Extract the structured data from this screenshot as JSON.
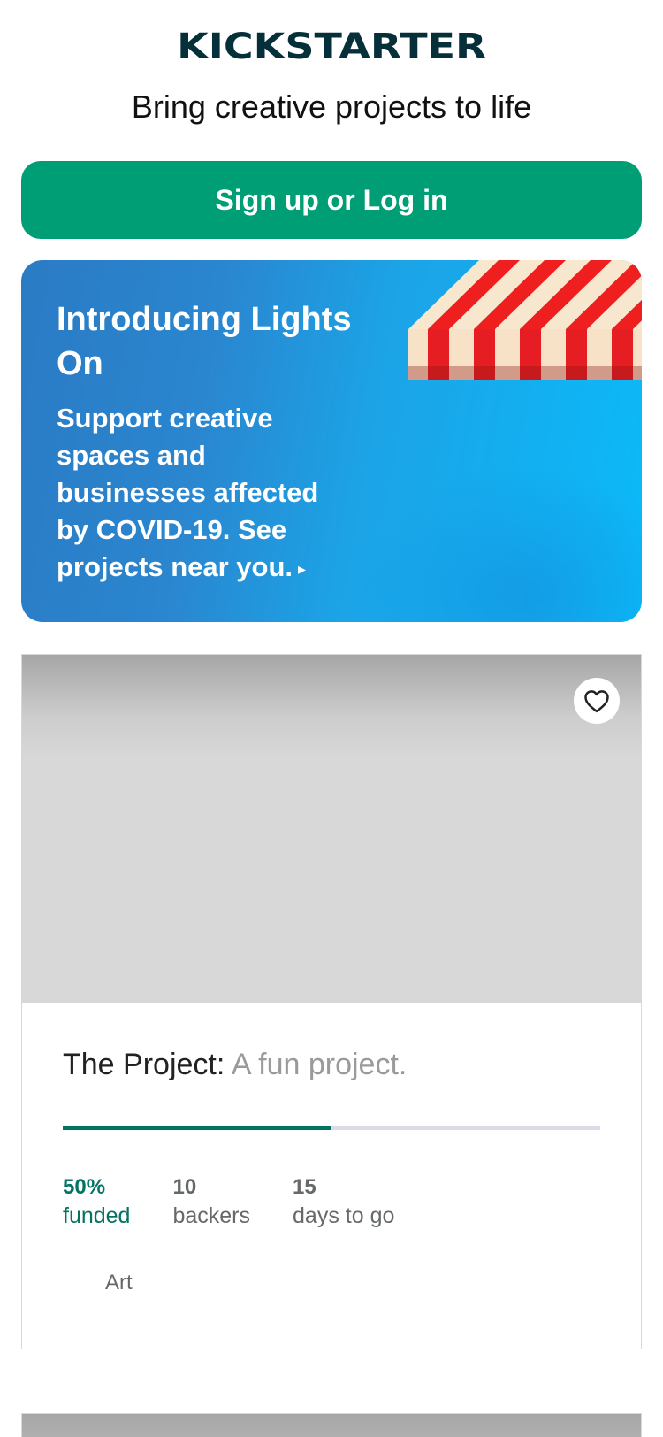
{
  "header": {
    "logo_text": "KICKSTARTER",
    "tagline": "Bring creative projects to life"
  },
  "auth": {
    "signup_label": "Sign up or Log in",
    "accent_color": "#009e74"
  },
  "promo": {
    "title": "Introducing Lights On",
    "body": "Support creative spaces and businesses affected by COVID-19. See projects near you.",
    "arrow": "▸"
  },
  "project": {
    "name": "The Project:",
    "blurb": "A fun project.",
    "funded_fraction": 0.5,
    "stats": {
      "funded_value": "50%",
      "funded_label": "funded",
      "backers_value": "10",
      "backers_label": "backers",
      "days_value": "15",
      "days_label": "days to go"
    },
    "category": "Art",
    "favorite_icon": "heart-icon"
  }
}
